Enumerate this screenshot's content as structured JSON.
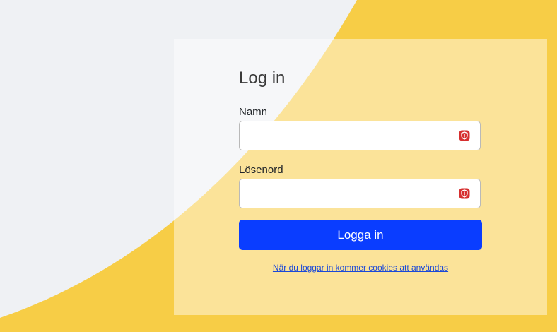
{
  "login": {
    "title": "Log in",
    "name_label": "Namn",
    "name_value": "",
    "password_label": "Lösenord",
    "password_value": "",
    "submit_label": "Logga in",
    "cookie_notice": "När du loggar in kommer cookies att användas"
  },
  "icons": {
    "field_icon": "password-manager-shield-icon"
  },
  "colors": {
    "background_yellow": "#f7cd46",
    "background_gray": "#eff1f4",
    "primary_button": "#0a3dff",
    "link": "#1a48d8",
    "password_manager_icon": "#d62f2f"
  }
}
